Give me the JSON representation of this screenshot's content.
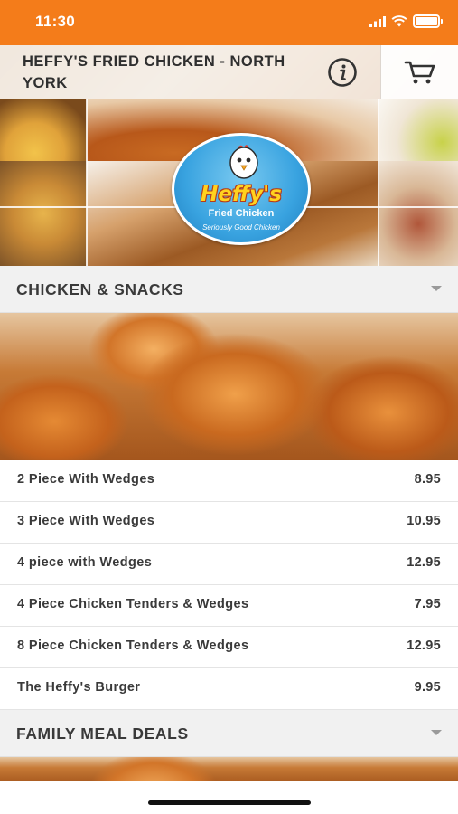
{
  "status_bar": {
    "time": "11:30"
  },
  "header": {
    "store_name": "HEFFY'S FRIED CHICKEN - NORTH YORK",
    "info_icon": "info-icon",
    "cart_icon": "cart-icon"
  },
  "logo": {
    "name": "Heffy's",
    "sub": "Fried Chicken",
    "tag": "Seriously Good Chicken"
  },
  "categories": [
    {
      "title": "CHICKEN & SNACKS"
    },
    {
      "title": "FAMILY MEAL DEALS"
    }
  ],
  "menu": {
    "items": [
      {
        "name": "2 Piece With Wedges",
        "price": "8.95"
      },
      {
        "name": "3 Piece With Wedges",
        "price": "10.95"
      },
      {
        "name": "4 piece with Wedges",
        "price": "12.95"
      },
      {
        "name": "4 Piece Chicken Tenders & Wedges",
        "price": "7.95"
      },
      {
        "name": "8 Piece Chicken Tenders & Wedges",
        "price": "12.95"
      },
      {
        "name": "The Heffy's Burger",
        "price": "9.95"
      }
    ]
  },
  "colors": {
    "accent": "#f47c1a",
    "text": "#3a3a3a",
    "category_bg": "#f1f1f1"
  }
}
